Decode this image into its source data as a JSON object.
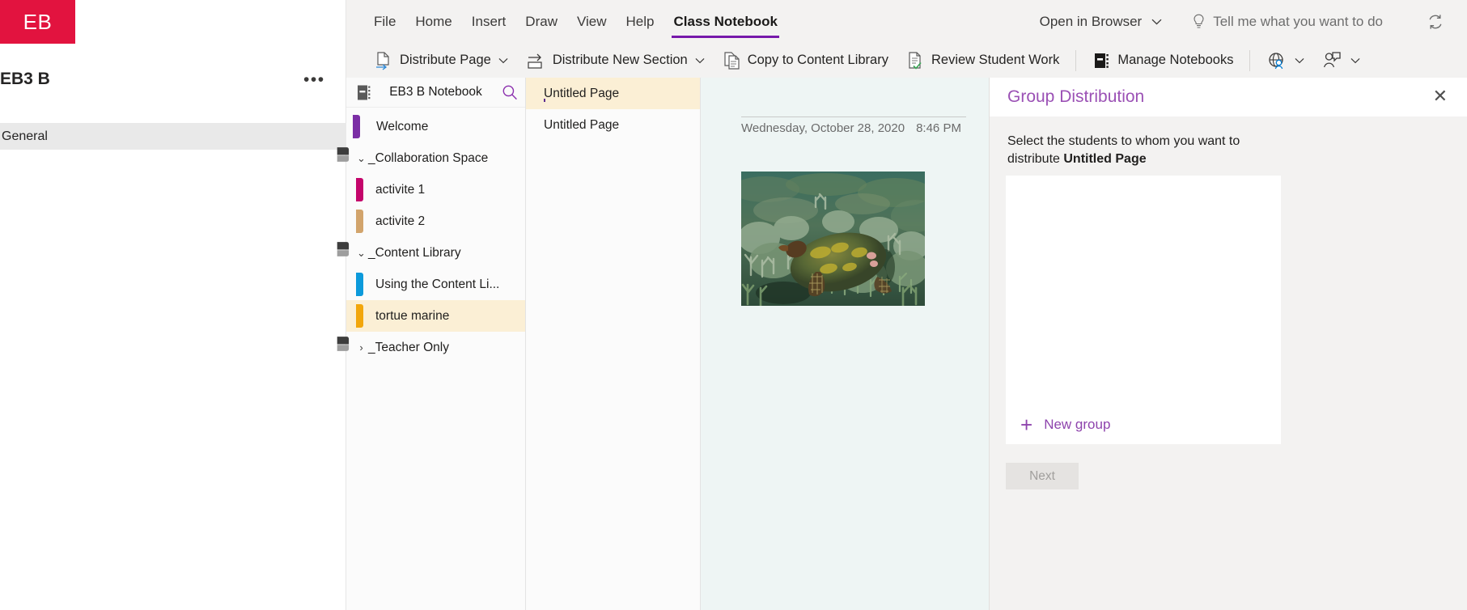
{
  "teams": {
    "avatar_initials": "EB",
    "team_name": "EB3 B",
    "more_label": "•••",
    "channel": "General"
  },
  "ribbon": {
    "tabs": [
      {
        "label": "File",
        "active": false
      },
      {
        "label": "Home",
        "active": false
      },
      {
        "label": "Insert",
        "active": false
      },
      {
        "label": "Draw",
        "active": false
      },
      {
        "label": "View",
        "active": false
      },
      {
        "label": "Help",
        "active": false
      },
      {
        "label": "Class Notebook",
        "active": true
      }
    ],
    "open_in_browser": "Open in Browser",
    "tell_me_placeholder": "Tell me what you want to do",
    "sync_icon": "sync-icon",
    "commands": [
      {
        "label": "Distribute Page",
        "icon": "distribute-page-icon",
        "caret": true
      },
      {
        "label": "Distribute New Section",
        "icon": "distribute-new-section-icon",
        "caret": true
      },
      {
        "label": "Copy to Content Library",
        "icon": "copy-to-content-library-icon",
        "caret": false
      },
      {
        "label": "Review Student Work",
        "icon": "review-student-work-icon",
        "caret": false
      },
      {
        "label": "Manage Notebooks",
        "icon": "manage-notebooks-icon",
        "caret": false
      }
    ],
    "globe_caret": "⌄",
    "people_caret": "⌄"
  },
  "notebook": {
    "name": "EB3 B Notebook",
    "icon": "notebook-icon",
    "search_icon": "search-icon",
    "sections": [
      {
        "label": "Welcome",
        "color": "#7B2EA5",
        "kind": "section",
        "indent": 0,
        "selected": false,
        "caret": ""
      },
      {
        "label": "_Collaboration Space",
        "color": "",
        "kind": "group",
        "indent": 0,
        "selected": false,
        "caret": "⌄"
      },
      {
        "label": "activite 1",
        "color": "#C4056B",
        "kind": "section",
        "indent": 1,
        "selected": false,
        "caret": ""
      },
      {
        "label": "activite 2",
        "color": "#D2A46C",
        "kind": "section",
        "indent": 1,
        "selected": false,
        "caret": ""
      },
      {
        "label": "_Content Library",
        "color": "",
        "kind": "group",
        "indent": 0,
        "selected": false,
        "caret": "⌄"
      },
      {
        "label": "Using the Content Li...",
        "color": "#0C9ADB",
        "kind": "section",
        "indent": 1,
        "selected": false,
        "caret": ""
      },
      {
        "label": "tortue marine",
        "color": "#F2A60C",
        "kind": "section",
        "indent": 1,
        "selected": true,
        "caret": ""
      },
      {
        "label": "_Teacher Only",
        "color": "",
        "kind": "group",
        "indent": 0,
        "selected": false,
        "caret": "›"
      }
    ]
  },
  "pages": [
    {
      "title": "Untitled Page",
      "selected": true
    },
    {
      "title": "Untitled Page",
      "selected": false
    }
  ],
  "canvas": {
    "date": "Wednesday, October 28, 2020",
    "time": "8:46 PM",
    "image_alt": "sea-turtle-coral-reef-photo"
  },
  "group_distribution": {
    "title": "Group Distribution",
    "close_icon": "close-icon",
    "instruction_prefix": "Select the students to whom you want to distribute ",
    "instruction_target": "Untitled Page",
    "new_group_label": "New group",
    "plus_icon": "plus-icon",
    "next_label": "Next"
  },
  "colors": {
    "accent_purple": "#7719aa",
    "team_red": "#E2133F",
    "selection_cream": "#fbefd5",
    "canvas_bg": "#eef5f4"
  }
}
